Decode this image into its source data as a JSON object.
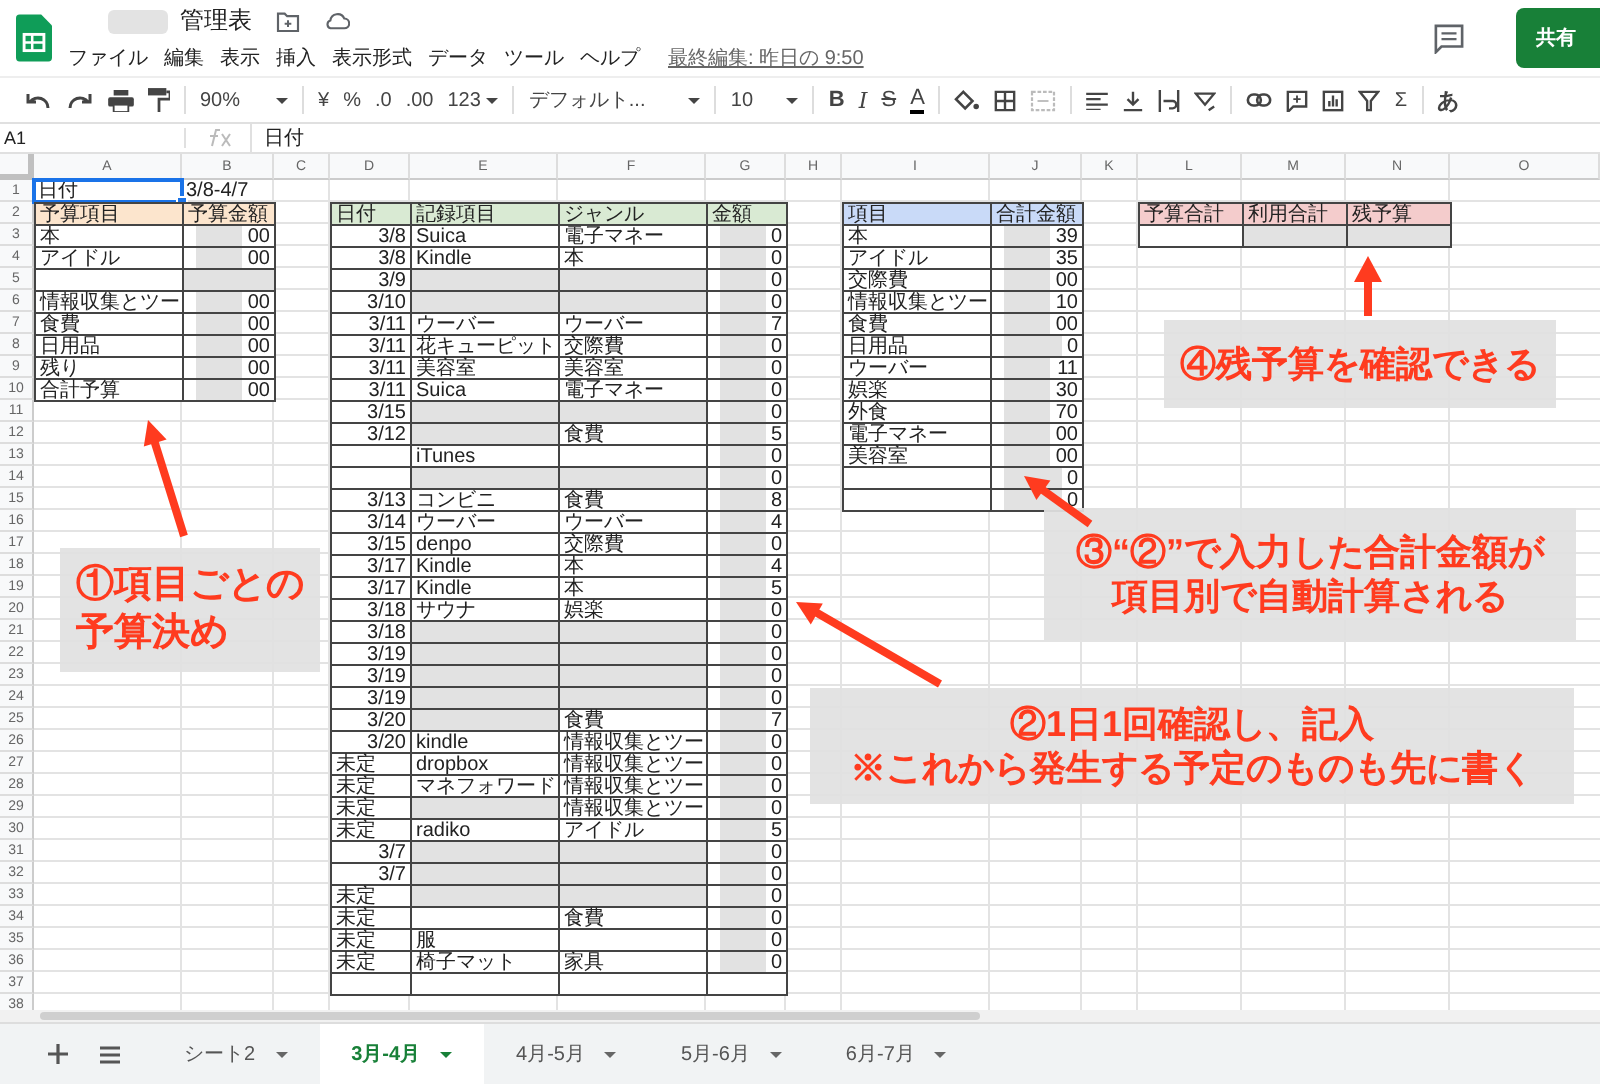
{
  "document": {
    "title": "管理表",
    "title_redacted": true,
    "menus": [
      "ファイル",
      "編集",
      "表示",
      "挿入",
      "表示形式",
      "データ",
      "ツール",
      "ヘルプ"
    ],
    "last_edit": "最終編集: 昨日の 9:50",
    "share": "共有"
  },
  "toolbar": {
    "zoom": "90%",
    "currency": "¥",
    "percent": "%",
    "decimal_less": ".0",
    "decimal_more": ".00",
    "number_format": "123",
    "font": "デフォルト...",
    "font_size": "10",
    "bold": "B",
    "italic": "I",
    "strike": "S",
    "text_color": "A",
    "function": "Σ",
    "input_mode": "あ"
  },
  "formula_bar": {
    "cell": "A1",
    "formula": "日付"
  },
  "sheet": {
    "columns": [
      "A",
      "B",
      "C",
      "D",
      "E",
      "F",
      "G",
      "H",
      "I",
      "J",
      "K",
      "L",
      "M",
      "N",
      "O"
    ],
    "rows": [
      "1",
      "2",
      "3",
      "4",
      "5",
      "6",
      "7",
      "8",
      "9",
      "10",
      "11",
      "12",
      "13",
      "14",
      "15",
      "16",
      "17",
      "18",
      "19",
      "20",
      "21",
      "22",
      "23",
      "24",
      "25",
      "26",
      "27",
      "28",
      "29",
      "30",
      "31",
      "32",
      "33",
      "34",
      "35",
      "36",
      "37",
      "38"
    ],
    "date_range": {
      "label": "日付",
      "value": "3/8-4/7",
      "selected": true
    },
    "tables": [
      {
        "color": "#fce5cd",
        "headers": [
          "予算項目",
          "予算金額"
        ],
        "rows": [
          [
            {
              "text": "本",
              "redacted": false
            },
            {
              "text": "00",
              "right_aligned": true,
              "redacted": true
            }
          ],
          [
            {
              "text": "アイドル",
              "redacted": false
            },
            {
              "text": "00",
              "right_aligned": true,
              "redacted": true
            }
          ],
          [
            {
              "redacted": false
            },
            {
              "redacted": true
            }
          ],
          [
            {
              "text": "情報収集とツー",
              "redacted": false
            },
            {
              "text": "00",
              "right_aligned": true,
              "redacted": true
            }
          ],
          [
            {
              "text": "食費",
              "redacted": false
            },
            {
              "text": "00",
              "right_aligned": true,
              "redacted": true
            }
          ],
          [
            {
              "text": "日用品",
              "redacted": false
            },
            {
              "text": "00",
              "right_aligned": true,
              "redacted": true
            }
          ],
          [
            {
              "text": "残り",
              "redacted": false
            },
            {
              "text": "00",
              "right_aligned": true,
              "redacted": true
            }
          ],
          [
            {
              "text": "合計予算",
              "redacted": false
            },
            {
              "text": "00",
              "right_aligned": true,
              "redacted": true
            }
          ]
        ]
      },
      {
        "color": "#d9ead3",
        "headers": [
          "日付",
          "記録項目",
          "ジャンル",
          "金額"
        ],
        "rows": [
          [
            {
              "text": "3/8",
              "right_aligned": true,
              "redacted": false
            },
            {
              "text": "Suica",
              "redacted": false
            },
            {
              "text": "電子マネー",
              "redacted": false
            },
            {
              "text": "0",
              "right_aligned": true,
              "redacted": true
            }
          ],
          [
            {
              "text": "3/8",
              "right_aligned": true,
              "redacted": false
            },
            {
              "text": "Kindle",
              "redacted": false
            },
            {
              "text": "本",
              "redacted": false
            },
            {
              "text": "0",
              "right_aligned": true,
              "redacted": true
            }
          ],
          [
            {
              "text": "3/9",
              "right_aligned": true,
              "redacted": false
            },
            {
              "redacted": true
            },
            {
              "redacted": true
            },
            {
              "text": "0",
              "right_aligned": true,
              "redacted": true
            }
          ],
          [
            {
              "text": "3/10",
              "right_aligned": true,
              "redacted": false
            },
            {
              "redacted": true
            },
            {
              "redacted": true
            },
            {
              "text": "0",
              "right_aligned": true,
              "redacted": true
            }
          ],
          [
            {
              "text": "3/11",
              "right_aligned": true,
              "redacted": false
            },
            {
              "text": "ウーバー",
              "redacted": false
            },
            {
              "text": "ウーバー",
              "redacted": false
            },
            {
              "text": "7",
              "right_aligned": true,
              "redacted": true
            }
          ],
          [
            {
              "text": "3/11",
              "right_aligned": true,
              "redacted": false
            },
            {
              "text": "花キューピット",
              "redacted": false
            },
            {
              "text": "交際費",
              "redacted": false
            },
            {
              "text": "0",
              "right_aligned": true,
              "redacted": true
            }
          ],
          [
            {
              "text": "3/11",
              "right_aligned": true,
              "redacted": false
            },
            {
              "text": "美容室",
              "redacted": false
            },
            {
              "text": "美容室",
              "redacted": false
            },
            {
              "text": "0",
              "right_aligned": true,
              "redacted": true
            }
          ],
          [
            {
              "text": "3/11",
              "right_aligned": true,
              "redacted": false
            },
            {
              "text": "Suica",
              "redacted": false
            },
            {
              "text": "電子マネー",
              "redacted": false
            },
            {
              "text": "0",
              "right_aligned": true,
              "redacted": true
            }
          ],
          [
            {
              "text": "3/15",
              "right_aligned": true,
              "redacted": false
            },
            {
              "redacted": true
            },
            {
              "redacted": true
            },
            {
              "text": "0",
              "right_aligned": true,
              "redacted": true
            }
          ],
          [
            {
              "text": "3/12",
              "right_aligned": true,
              "redacted": false
            },
            {
              "redacted": true
            },
            {
              "text": "食費",
              "redacted": false
            },
            {
              "text": "5",
              "right_aligned": true,
              "redacted": true
            }
          ],
          [
            {
              "redacted": false
            },
            {
              "text": "iTunes",
              "redacted": false
            },
            {
              "redacted": false
            },
            {
              "text": "0",
              "right_aligned": true,
              "redacted": true
            }
          ],
          [
            {
              "redacted": false
            },
            {
              "redacted": true
            },
            {
              "redacted": true
            },
            {
              "text": "0",
              "right_aligned": true,
              "redacted": true
            }
          ],
          [
            {
              "text": "3/13",
              "right_aligned": true,
              "redacted": false
            },
            {
              "text": "コンビニ",
              "redacted": false
            },
            {
              "text": "食費",
              "redacted": false
            },
            {
              "text": "8",
              "right_aligned": true,
              "redacted": true
            }
          ],
          [
            {
              "text": "3/14",
              "right_aligned": true,
              "redacted": false
            },
            {
              "text": "ウーバー",
              "redacted": false
            },
            {
              "text": "ウーバー",
              "redacted": false
            },
            {
              "text": "4",
              "right_aligned": true,
              "redacted": true
            }
          ],
          [
            {
              "text": "3/15",
              "right_aligned": true,
              "redacted": false
            },
            {
              "text": "denpo",
              "redacted": false
            },
            {
              "text": "交際費",
              "redacted": false
            },
            {
              "text": "0",
              "right_aligned": true,
              "redacted": true
            }
          ],
          [
            {
              "text": "3/17",
              "right_aligned": true,
              "redacted": false
            },
            {
              "text": "Kindle",
              "redacted": false
            },
            {
              "text": "本",
              "redacted": false
            },
            {
              "text": "4",
              "right_aligned": true,
              "redacted": true
            }
          ],
          [
            {
              "text": "3/17",
              "right_aligned": true,
              "redacted": false
            },
            {
              "text": "Kindle",
              "redacted": false
            },
            {
              "text": "本",
              "redacted": false
            },
            {
              "text": "5",
              "right_aligned": true,
              "redacted": true
            }
          ],
          [
            {
              "text": "3/18",
              "right_aligned": true,
              "redacted": false
            },
            {
              "text": "サウナ",
              "redacted": false
            },
            {
              "text": "娯楽",
              "redacted": false
            },
            {
              "text": "0",
              "right_aligned": true,
              "redacted": true
            }
          ],
          [
            {
              "text": "3/18",
              "right_aligned": true,
              "redacted": false
            },
            {
              "redacted": true
            },
            {
              "redacted": true
            },
            {
              "text": "0",
              "right_aligned": true,
              "redacted": true
            }
          ],
          [
            {
              "text": "3/19",
              "right_aligned": true,
              "redacted": false
            },
            {
              "redacted": true
            },
            {
              "redacted": true
            },
            {
              "text": "0",
              "right_aligned": true,
              "redacted": true
            }
          ],
          [
            {
              "text": "3/19",
              "right_aligned": true,
              "redacted": false
            },
            {
              "redacted": true
            },
            {
              "redacted": true
            },
            {
              "text": "0",
              "right_aligned": true,
              "redacted": true
            }
          ],
          [
            {
              "text": "3/19",
              "right_aligned": true,
              "redacted": false
            },
            {
              "redacted": true
            },
            {
              "redacted": true
            },
            {
              "text": "0",
              "right_aligned": true,
              "redacted": true
            }
          ],
          [
            {
              "text": "3/20",
              "right_aligned": true,
              "redacted": false
            },
            {
              "redacted": true
            },
            {
              "text": "食費",
              "redacted": false
            },
            {
              "text": "7",
              "right_aligned": true,
              "redacted": true
            }
          ],
          [
            {
              "text": "3/20",
              "right_aligned": true,
              "redacted": false
            },
            {
              "text": "kindle",
              "redacted": false
            },
            {
              "text": "情報収集とツー",
              "redacted": false
            },
            {
              "text": "0",
              "right_aligned": true,
              "redacted": true
            }
          ],
          [
            {
              "text": "未定",
              "redacted": false
            },
            {
              "text": "dropbox",
              "redacted": false
            },
            {
              "text": "情報収集とツー",
              "redacted": false
            },
            {
              "text": "0",
              "right_aligned": true,
              "redacted": true
            }
          ],
          [
            {
              "text": "未定",
              "redacted": false
            },
            {
              "text": "マネフォワード",
              "redacted": false
            },
            {
              "text": "情報収集とツー",
              "redacted": false
            },
            {
              "text": "0",
              "right_aligned": true,
              "redacted": true
            }
          ],
          [
            {
              "text": "未定",
              "redacted": false
            },
            {
              "redacted": true
            },
            {
              "text": "情報収集とツー",
              "redacted": false
            },
            {
              "text": "0",
              "right_aligned": true,
              "redacted": true
            }
          ],
          [
            {
              "text": "未定",
              "redacted": false
            },
            {
              "text": "radiko",
              "redacted": false
            },
            {
              "text": "アイドル",
              "redacted": false
            },
            {
              "text": "5",
              "right_aligned": true,
              "redacted": true
            }
          ],
          [
            {
              "text": "3/7",
              "right_aligned": true,
              "redacted": false
            },
            {
              "redacted": true
            },
            {
              "redacted": true
            },
            {
              "text": "0",
              "right_aligned": true,
              "redacted": true
            }
          ],
          [
            {
              "text": "3/7",
              "right_aligned": true,
              "redacted": false
            },
            {
              "redacted": true
            },
            {
              "redacted": true
            },
            {
              "text": "0",
              "right_aligned": true,
              "redacted": true
            }
          ],
          [
            {
              "text": "未定",
              "redacted": false
            },
            {
              "redacted": true
            },
            {
              "redacted": true
            },
            {
              "text": "0",
              "right_aligned": true,
              "redacted": true
            }
          ],
          [
            {
              "text": "未定",
              "redacted": false
            },
            {
              "redacted": false
            },
            {
              "text": "食費",
              "redacted": false
            },
            {
              "text": "0",
              "right_aligned": true,
              "redacted": true
            }
          ],
          [
            {
              "text": "未定",
              "redacted": false
            },
            {
              "text": "服",
              "redacted": false
            },
            {
              "redacted": false
            },
            {
              "text": "0",
              "right_aligned": true,
              "redacted": true
            }
          ],
          [
            {
              "text": "未定",
              "redacted": false
            },
            {
              "text": "椅子マット",
              "redacted": false
            },
            {
              "text": "家具",
              "redacted": false
            },
            {
              "text": "0",
              "right_aligned": true,
              "redacted": true
            }
          ],
          [
            {
              "redacted": false
            },
            {
              "redacted": false
            },
            {
              "redacted": false
            },
            {
              "redacted": false
            }
          ]
        ]
      },
      {
        "color": "#c9daf8",
        "headers": [
          "項目",
          "合計金額"
        ],
        "rows": [
          [
            {
              "text": "本",
              "redacted": false
            },
            {
              "text": "39",
              "right_aligned": true,
              "redacted": true
            }
          ],
          [
            {
              "text": "アイドル",
              "redacted": false
            },
            {
              "text": "35",
              "right_aligned": true,
              "redacted": true
            }
          ],
          [
            {
              "text": "交際費",
              "redacted": false
            },
            {
              "text": "00",
              "right_aligned": true,
              "redacted": true
            }
          ],
          [
            {
              "text": "情報収集とツー",
              "redacted": false
            },
            {
              "text": "10",
              "right_aligned": true,
              "redacted": true
            }
          ],
          [
            {
              "text": "食費",
              "redacted": false
            },
            {
              "text": "00",
              "right_aligned": true,
              "redacted": true
            }
          ],
          [
            {
              "text": "日用品",
              "redacted": false
            },
            {
              "text": "0",
              "right_aligned": true,
              "redacted": true
            }
          ],
          [
            {
              "text": "ウーバー",
              "redacted": false
            },
            {
              "text": "11",
              "right_aligned": true,
              "redacted": true
            }
          ],
          [
            {
              "text": "娯楽",
              "redacted": false
            },
            {
              "text": "30",
              "right_aligned": true,
              "redacted": true
            }
          ],
          [
            {
              "text": "外食",
              "redacted": false
            },
            {
              "text": "70",
              "right_aligned": true,
              "redacted": true
            }
          ],
          [
            {
              "text": "電子マネー",
              "redacted": false
            },
            {
              "text": "00",
              "right_aligned": true,
              "redacted": true
            }
          ],
          [
            {
              "text": "美容室",
              "redacted": false
            },
            {
              "text": "00",
              "right_aligned": true,
              "redacted": true
            }
          ],
          [
            {
              "redacted": false
            },
            {
              "text": "0",
              "right_aligned": true,
              "redacted": true
            }
          ],
          [
            {
              "redacted": false
            },
            {
              "text": "0",
              "right_aligned": true,
              "redacted": true
            }
          ]
        ]
      },
      {
        "color": "#f4cccc",
        "headers": [
          "予算合計",
          "利用合計",
          "残予算"
        ],
        "rows": [
          [
            {
              "redacted": false
            },
            {
              "redacted": true
            },
            {
              "redacted": true
            }
          ]
        ]
      }
    ]
  },
  "annotations": [
    {
      "lines": [
        "④残予算を確認できる"
      ]
    },
    {
      "lines": [
        "③“②”で入力した合計金額が",
        "項目別で自動計算される"
      ]
    },
    {
      "lines": [
        "①項目ごとの",
        "予算決め"
      ]
    },
    {
      "lines": [
        "②1日1回確認し、記入",
        "※これから発生する予定のものも先に書く"
      ]
    }
  ],
  "sheet_tabs": [
    {
      "label": "シート2",
      "selected": false
    },
    {
      "label": "3月-4月",
      "selected": true
    },
    {
      "label": "4月-5月",
      "selected": false
    },
    {
      "label": "5月-6月",
      "selected": false
    },
    {
      "label": "6月-7月",
      "selected": false
    }
  ]
}
